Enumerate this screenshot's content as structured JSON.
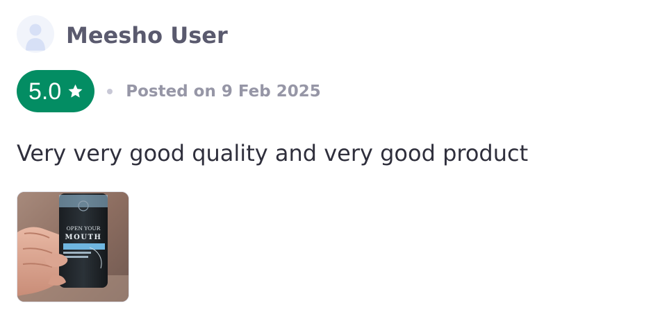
{
  "review": {
    "user": {
      "name": "Meesho User",
      "avatar_icon": "user-silhouette-icon"
    },
    "rating": {
      "value": "5.0",
      "icon": "star-icon",
      "badge_color": "#038d63"
    },
    "posted": "Posted on 9 Feb 2025",
    "text": "Very very good quality and very good product",
    "photos": [
      {
        "alt": "Customer photo of product in hand",
        "label_lines": [
          "OPEN YOUR",
          "MOUTH"
        ]
      }
    ]
  }
}
